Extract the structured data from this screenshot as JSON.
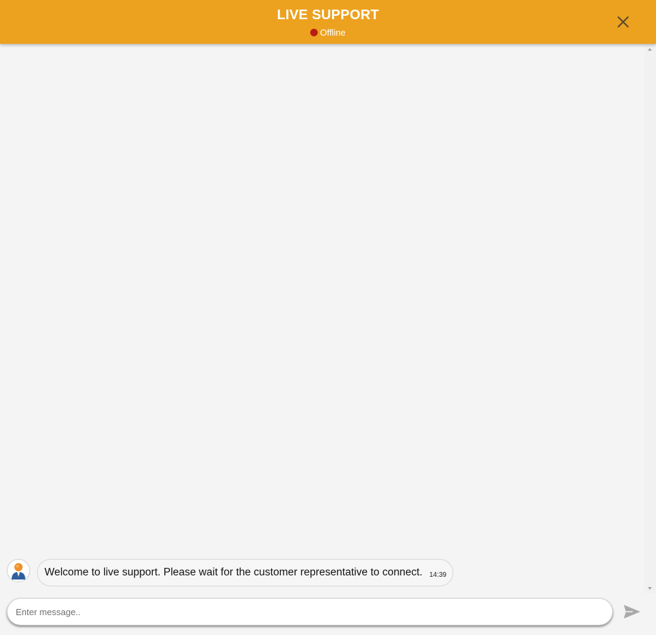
{
  "header": {
    "title": "LIVE SUPPORT",
    "status": "Offline",
    "status_color": "#b81d12",
    "background_color": "#eca21f",
    "close_icon": "close-icon"
  },
  "messages": [
    {
      "sender_icon": "agent-avatar-icon",
      "text": "Welcome to live support. Please wait for the customer representative to connect.",
      "time": "14:39"
    }
  ],
  "composer": {
    "placeholder": "Enter message..",
    "value": "",
    "send_icon": "send-icon"
  }
}
